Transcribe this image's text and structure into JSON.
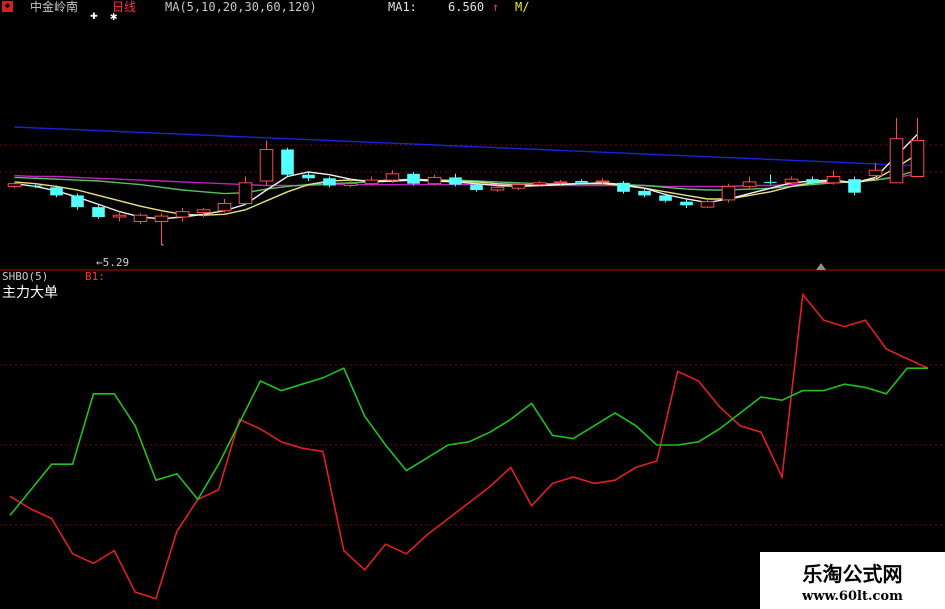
{
  "header": {
    "stock_name": "中金岭南",
    "period": "日线",
    "ma_label": "MA(5,10,20,30,60,120)",
    "ma1_label": "MA1:",
    "ma1_value": "6.560",
    "ma1_arrow": "↑",
    "ma_more": "M/",
    "marker_a": "✚",
    "marker_b": "✱"
  },
  "colors": {
    "background": "#000000",
    "grid": "#800000",
    "axis": "#c00000",
    "up_candle": "#ff4a4a",
    "down_candle": "#54ffff",
    "ma_blue": "#1a22d8",
    "ma_magenta": "#c020c0",
    "ma_green": "#54c060",
    "ma_yellow": "#e8e080",
    "ma_white": "#f0f0f0",
    "ind_red": "#e02020",
    "ind_green": "#20c020"
  },
  "indicator": {
    "name": "SHBO(5)",
    "b1": "B1:",
    "title": "主力大单"
  },
  "low_label": "←5.29",
  "watermark": {
    "title": "乐淘公式网",
    "url": "www.60lt.com"
  },
  "chart_data": [
    {
      "type": "candlestick",
      "ylim": [
        5.1,
        6.9
      ],
      "grid": true,
      "x": [
        0,
        1,
        2,
        3,
        4,
        5,
        6,
        7,
        8,
        9,
        10,
        11,
        12,
        13,
        14,
        15,
        16,
        17,
        18,
        19,
        20,
        21,
        22,
        23,
        24,
        25,
        26,
        27,
        28,
        29,
        30,
        31,
        32,
        33,
        34,
        35,
        36,
        37,
        38,
        39,
        40,
        41,
        42,
        43
      ],
      "open": [
        5.94,
        5.95,
        5.93,
        5.84,
        5.71,
        5.6,
        5.55,
        5.55,
        5.6,
        5.65,
        5.67,
        5.75,
        6.0,
        6.35,
        6.07,
        6.03,
        5.95,
        5.97,
        6.01,
        6.08,
        5.97,
        6.04,
        5.96,
        5.9,
        5.92,
        5.96,
        5.98,
        6.0,
        5.99,
        5.98,
        5.89,
        5.84,
        5.77,
        5.71,
        5.79,
        5.94,
        5.99,
        5.98,
        6.02,
        5.98,
        6.02,
        6.06,
        5.98,
        6.05
      ],
      "close": [
        5.97,
        5.94,
        5.84,
        5.71,
        5.6,
        5.62,
        5.62,
        5.61,
        5.66,
        5.68,
        5.75,
        5.98,
        6.35,
        6.07,
        6.03,
        5.95,
        5.97,
        6.01,
        6.08,
        5.97,
        6.04,
        5.96,
        5.9,
        5.93,
        5.96,
        5.98,
        5.99,
        5.98,
        6.0,
        5.88,
        5.84,
        5.78,
        5.73,
        5.77,
        5.94,
        5.99,
        5.98,
        6.02,
        5.98,
        6.05,
        5.87,
        6.12,
        6.47,
        6.45
      ],
      "high": [
        5.98,
        5.96,
        5.95,
        5.86,
        5.73,
        5.66,
        5.64,
        5.64,
        5.7,
        5.7,
        5.8,
        6.05,
        6.45,
        6.37,
        6.1,
        6.05,
        6.02,
        6.05,
        6.12,
        6.1,
        6.07,
        6.08,
        6.0,
        5.95,
        5.98,
        6.0,
        6.01,
        6.02,
        6.03,
        6.0,
        5.91,
        5.86,
        5.8,
        5.8,
        5.97,
        6.05,
        6.07,
        6.05,
        6.05,
        6.12,
        6.05,
        6.2,
        6.7,
        6.7
      ],
      "low": [
        5.92,
        5.92,
        5.82,
        5.68,
        5.58,
        5.55,
        5.52,
        5.29,
        5.55,
        5.6,
        5.65,
        5.73,
        5.95,
        6.05,
        6.0,
        5.93,
        5.93,
        5.95,
        5.98,
        5.95,
        5.95,
        5.94,
        5.88,
        5.88,
        5.9,
        5.94,
        5.96,
        5.96,
        5.97,
        5.86,
        5.82,
        5.76,
        5.7,
        5.7,
        5.76,
        5.92,
        5.96,
        5.96,
        5.96,
        5.96,
        5.84,
        6.0,
        6.0,
        6.4
      ],
      "low_marker_index": 7,
      "low_marker_value": 5.29,
      "series": [
        {
          "values": [
            6.6,
            6.59,
            6.58,
            6.57,
            6.56,
            6.55,
            6.54,
            6.53,
            6.52,
            6.51,
            6.5,
            6.49,
            6.48,
            6.47,
            6.46,
            6.45,
            6.44,
            6.43,
            6.42,
            6.41,
            6.4,
            6.39,
            6.38,
            6.37,
            6.36,
            6.35,
            6.34,
            6.33,
            6.32,
            6.31,
            6.3,
            6.29,
            6.28,
            6.27,
            6.26,
            6.25,
            6.24,
            6.23,
            6.22,
            6.21,
            6.2,
            6.19,
            6.18,
            6.17
          ],
          "color_key": "ma_blue"
        },
        {
          "values": [
            6.06,
            6.05,
            6.05,
            6.04,
            6.03,
            6.02,
            6.01,
            6.0,
            5.99,
            5.98,
            5.97,
            5.96,
            5.95,
            5.95,
            5.95,
            5.96,
            5.96,
            5.96,
            5.96,
            5.96,
            5.96,
            5.96,
            5.96,
            5.96,
            5.96,
            5.95,
            5.95,
            5.95,
            5.95,
            5.95,
            5.95,
            5.94,
            5.94,
            5.94,
            5.94,
            5.95,
            5.95,
            5.96,
            5.97,
            5.98,
            5.99,
            6.01,
            6.04,
            6.08
          ],
          "color_key": "ma_magenta"
        },
        {
          "values": [
            6.04,
            6.03,
            6.02,
            6.01,
            6.0,
            5.98,
            5.96,
            5.93,
            5.9,
            5.88,
            5.86,
            5.87,
            5.91,
            5.94,
            5.96,
            5.97,
            5.98,
            5.99,
            6.0,
            6.01,
            6.01,
            6.01,
            6.0,
            5.99,
            5.98,
            5.97,
            5.97,
            5.97,
            5.97,
            5.96,
            5.95,
            5.93,
            5.91,
            5.9,
            5.9,
            5.91,
            5.92,
            5.94,
            5.96,
            5.98,
            5.99,
            6.01,
            6.05,
            6.12
          ],
          "color_key": "ma_green"
        },
        {
          "values": [
            5.99,
            5.97,
            5.94,
            5.9,
            5.84,
            5.78,
            5.72,
            5.67,
            5.63,
            5.62,
            5.63,
            5.68,
            5.78,
            5.88,
            5.96,
            6.0,
            6.01,
            6.0,
            6.01,
            6.02,
            6.01,
            6.0,
            5.99,
            5.97,
            5.96,
            5.95,
            5.96,
            5.97,
            5.97,
            5.95,
            5.92,
            5.88,
            5.84,
            5.8,
            5.8,
            5.84,
            5.88,
            5.94,
            5.98,
            6.0,
            5.98,
            6.02,
            6.15,
            6.3
          ],
          "color_key": "ma_yellow"
        },
        {
          "values": [
            5.97,
            5.94,
            5.89,
            5.82,
            5.74,
            5.66,
            5.6,
            5.58,
            5.6,
            5.63,
            5.67,
            5.74,
            5.9,
            6.05,
            6.1,
            6.07,
            6.02,
            5.99,
            6.0,
            6.01,
            6.0,
            5.99,
            5.97,
            5.95,
            5.94,
            5.95,
            5.96,
            5.97,
            5.98,
            5.96,
            5.92,
            5.85,
            5.8,
            5.76,
            5.8,
            5.86,
            5.92,
            5.98,
            6.0,
            6.01,
            5.98,
            6.04,
            6.28,
            6.52
          ],
          "color_key": "ma_white"
        }
      ]
    },
    {
      "type": "line",
      "ylim": [
        0,
        100
      ],
      "grid": true,
      "x": [
        0,
        1,
        2,
        3,
        4,
        5,
        6,
        7,
        8,
        9,
        10,
        11,
        12,
        13,
        14,
        15,
        16,
        17,
        18,
        19,
        20,
        21,
        22,
        23,
        24,
        25,
        26,
        27,
        28,
        29,
        30,
        31,
        32,
        33,
        34,
        35,
        36,
        37,
        38,
        39,
        40,
        41,
        42,
        43,
        44
      ],
      "series": [
        {
          "values": [
            34,
            30,
            27,
            16,
            13,
            17,
            4,
            2,
            23,
            33,
            36,
            58,
            55,
            51,
            49,
            48,
            17,
            11,
            19,
            16,
            22,
            27,
            32,
            37,
            43,
            31,
            38,
            40,
            38,
            39,
            43,
            45,
            73,
            70,
            62,
            56,
            54,
            40,
            97,
            89,
            87,
            89,
            80,
            77,
            74
          ],
          "color_key": "ind_red"
        },
        {
          "values": [
            28,
            36,
            44,
            44,
            66,
            66,
            56,
            39,
            41,
            33,
            44,
            57,
            70,
            67,
            69,
            71,
            74,
            59,
            50,
            42,
            46,
            50,
            51,
            54,
            58,
            63,
            53,
            52,
            56,
            60,
            56,
            50,
            50,
            51,
            55,
            60,
            65,
            64,
            67,
            67,
            69,
            68,
            66,
            74,
            74
          ],
          "color_key": "ind_green"
        }
      ]
    }
  ]
}
